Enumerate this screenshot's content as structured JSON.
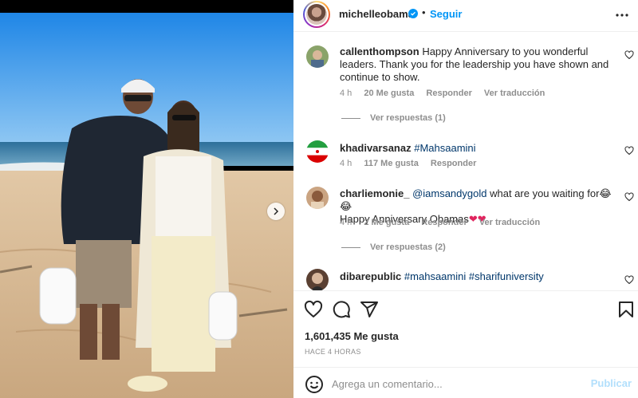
{
  "header": {
    "username": "michelleobama",
    "dot": "•",
    "follow_label": "Seguir"
  },
  "comments": [
    {
      "username": "callenthompson",
      "text": "Happy Anniversary to you wonderful leaders. Thank you for the leadership you have shown and continue to show.",
      "time": "4 h",
      "likes": "20 Me gusta",
      "reply_label": "Responder",
      "translate_label": "Ver traducción",
      "view_replies": "Ver respuestas (1)"
    },
    {
      "username": "khadivarsanaz",
      "hashtag": "#Mahsaamini",
      "time": "4 h",
      "likes": "117 Me gusta",
      "reply_label": "Responder"
    },
    {
      "username": "charliemonie_",
      "mention": "@iamsandygold",
      "text": "what are you waiting for",
      "emoji": "😂😂",
      "text2": "Happy Anniversary Obamas",
      "time": "4 h",
      "likes": "2 Me gusta",
      "reply_label": "Responder",
      "translate_label": "Ver traducción",
      "view_replies": "Ver respuestas (2)"
    },
    {
      "username": "dibarepublic",
      "hashtag1": "#mahsaamini",
      "hashtag2": "#sharifuniversity"
    }
  ],
  "post": {
    "likes": "1,601,435 Me gusta",
    "time": "HACE 4 HORAS",
    "comment_placeholder": "Agrega un comentario...",
    "publish_label": "Publicar"
  },
  "colors": {
    "accent": "#0095f6",
    "link": "#00376b",
    "muted": "#8e8e8e",
    "text": "#262626"
  },
  "icons": [
    "verified-badge-icon",
    "more-options-icon",
    "heart-icon",
    "comment-icon",
    "share-icon",
    "save-icon",
    "emoji-icon",
    "chevron-right-icon"
  ]
}
